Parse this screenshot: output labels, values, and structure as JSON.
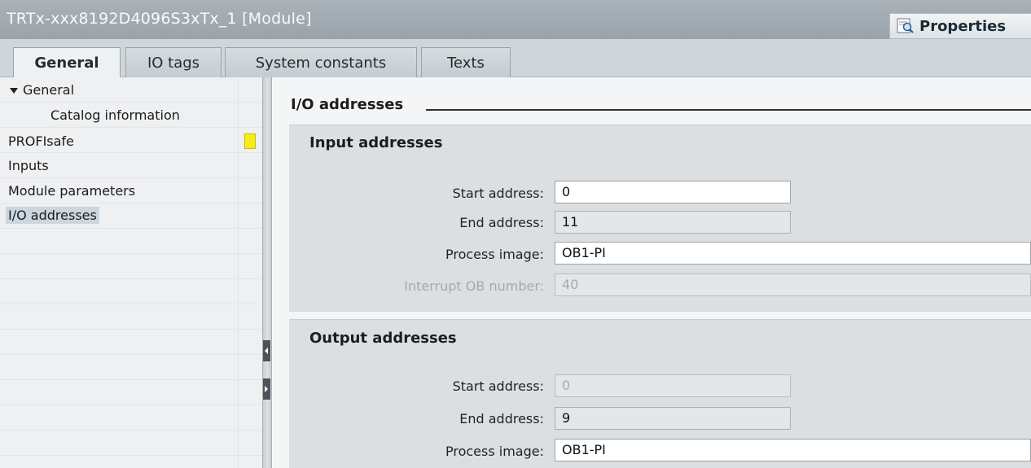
{
  "window": {
    "title": "TRTx-xxx8192D4096S3xTx_1 [Module]",
    "properties_label": "Properties"
  },
  "tabs": [
    {
      "label": "General"
    },
    {
      "label": "IO tags"
    },
    {
      "label": "System constants"
    },
    {
      "label": "Texts"
    }
  ],
  "nav": {
    "general": "General",
    "catalog": "Catalog information",
    "profisafe": "PROFIsafe",
    "inputs": "Inputs",
    "module_params": "Module parameters",
    "io_addresses": "I/O addresses"
  },
  "main": {
    "section_title": "I/O addresses",
    "input": {
      "title": "Input addresses",
      "start_label": "Start address:",
      "start_value": "0",
      "end_label": "End address:",
      "end_value": "11",
      "pi_label": "Process image:",
      "pi_value": "OB1-PI",
      "ob_label": "Interrupt OB number:",
      "ob_value": "40"
    },
    "output": {
      "title": "Output addresses",
      "start_label": "Start address:",
      "start_value": "0",
      "end_label": "End address:",
      "end_value": "9",
      "pi_label": "Process image:",
      "pi_value": "OB1-PI"
    }
  },
  "colors": {
    "status_marker": "#f7ec1a",
    "selected_nav": "#ccd6de"
  }
}
